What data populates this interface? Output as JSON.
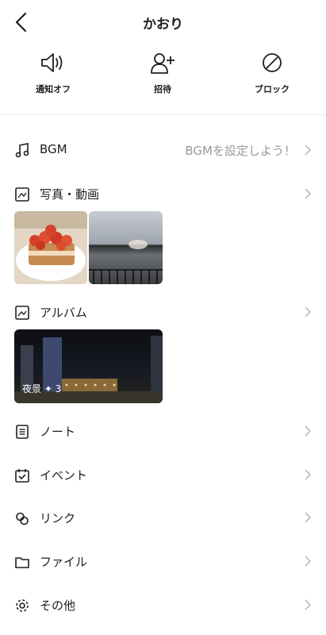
{
  "header": {
    "title": "かおり"
  },
  "actions": [
    {
      "label": "通知オフ"
    },
    {
      "label": "招待"
    },
    {
      "label": "ブロック"
    }
  ],
  "rows": {
    "bgm": {
      "label": "BGM",
      "value": "BGMを設定しよう！"
    },
    "photos": {
      "label": "写真・動画"
    },
    "album": {
      "label": "アルバム"
    },
    "note": {
      "label": "ノート"
    },
    "event": {
      "label": "イベント"
    },
    "link": {
      "label": "リンク"
    },
    "file": {
      "label": "ファイル"
    },
    "other": {
      "label": "その他"
    }
  },
  "album_card": {
    "caption": "夜景 ✦ 3"
  },
  "colors": {
    "text": "#1e1e1e",
    "muted": "#9a9a9a",
    "chevron": "#bdbdbd",
    "separator": "#ececec"
  }
}
